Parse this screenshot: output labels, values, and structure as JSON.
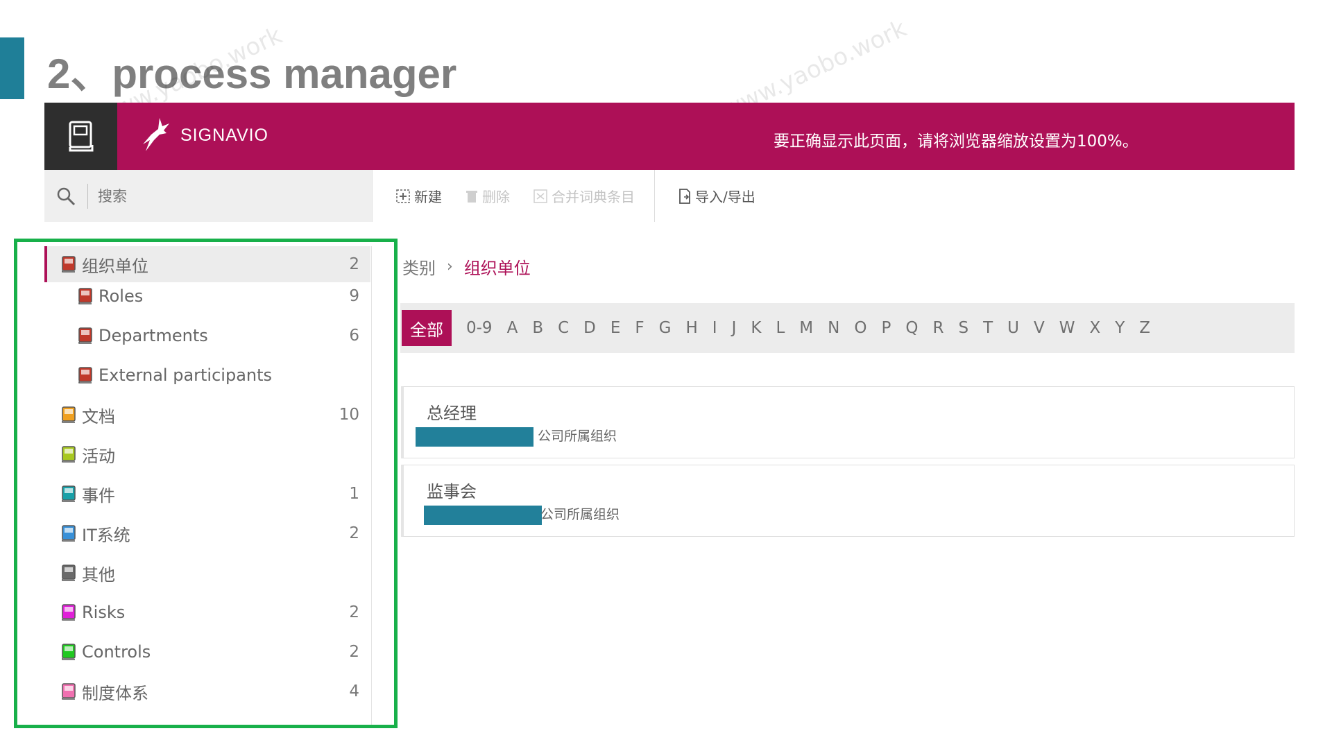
{
  "slide": {
    "title": "2、process manager"
  },
  "header": {
    "brand": "SIGNAVIO",
    "banner": "要正确显示此页面，请将浏览器缩放设置为100%。"
  },
  "search": {
    "placeholder": "搜索"
  },
  "toolbar": {
    "new": "新建",
    "delete": "删除",
    "merge": "合并词典条目",
    "import_export": "导入/导出"
  },
  "sidebar": {
    "items": [
      {
        "label": "组织单位",
        "count": "2",
        "color": "#c0392b"
      },
      {
        "label": "Roles",
        "count": "9",
        "color": "#c0392b"
      },
      {
        "label": "Departments",
        "count": "6",
        "color": "#c0392b"
      },
      {
        "label": "External participants",
        "count": "",
        "color": "#c0392b"
      },
      {
        "label": "文档",
        "count": "10",
        "color": "#f0a020"
      },
      {
        "label": "活动",
        "count": "",
        "color": "#a8c820"
      },
      {
        "label": "事件",
        "count": "1",
        "color": "#18a0a8"
      },
      {
        "label": "IT系统",
        "count": "2",
        "color": "#3890d8"
      },
      {
        "label": "其他",
        "count": "",
        "color": "#6a6a6a"
      },
      {
        "label": "Risks",
        "count": "2",
        "color": "#e020d8"
      },
      {
        "label": "Controls",
        "count": "2",
        "color": "#20c820"
      },
      {
        "label": "制度体系",
        "count": "4",
        "color": "#f070b0"
      }
    ]
  },
  "breadcrumb": {
    "root": "类别",
    "current": "组织单位"
  },
  "alphabet": {
    "all": "全部",
    "letters": [
      "0-9",
      "A",
      "B",
      "C",
      "D",
      "E",
      "F",
      "G",
      "H",
      "I",
      "J",
      "K",
      "L",
      "M",
      "N",
      "O",
      "P",
      "Q",
      "R",
      "S",
      "T",
      "U",
      "V",
      "W",
      "X",
      "Y",
      "Z"
    ]
  },
  "entries": [
    {
      "name": "总经理",
      "description": "公司所属组织"
    },
    {
      "name": "监事会",
      "description": "公司所属组织"
    }
  ],
  "watermark": "www.yaobo.work",
  "colors": {
    "accent": "#ad1057",
    "highlight": "#18b04a",
    "redaction": "#22809a"
  }
}
